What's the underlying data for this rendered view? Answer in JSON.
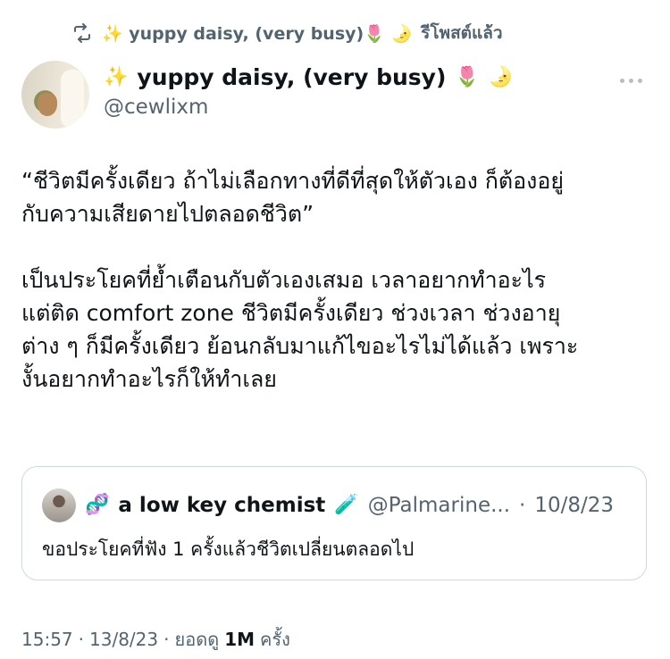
{
  "retweet": {
    "icon": "retweet-icon",
    "user_name": "✨ yuppy daisy, (very busy)🌷 🌛",
    "label": "รีโพสต์แล้ว"
  },
  "author": {
    "display_name": "yuppy daisy, (very busy)",
    "emoji_before": "✨",
    "emoji_after_1": "🌷",
    "emoji_after_2": "🌛",
    "handle": "@cewlixm"
  },
  "tweet": {
    "paragraph1_line1": "“ชีวิตมีครั้งเดียว ถ้าไม่เลือกทางที่ดีที่สุดให้ตัวเอง ก็ต้องอยู่",
    "paragraph1_line2": "กับความเสียดายไปตลอดชีวิต”",
    "paragraph2_line1": "เป็นประโยคที่ย้ำเตือนกับตัวเองเสมอ เวลาอยากทำอะไร",
    "paragraph2_line2": "แต่ติด comfort zone ชีวิตมีครั้งเดียว ช่วงเวลา ช่วงอายุ",
    "paragraph2_line3": "ต่าง ๆ ก็มีครั้งเดียว ย้อนกลับมาแก้ไขอะไรไม่ได้แล้ว เพราะ",
    "paragraph2_line4": "งั้นอยากทำอะไรก็ให้ทำเลย"
  },
  "quote": {
    "emoji_before": "🧬",
    "name": "a low key chemist",
    "emoji_after": "🧪",
    "handle": "@Palmarine...",
    "separator": "·",
    "date": "10/8/23",
    "text": "ขอประโยคที่ฟัง 1 ครั้งแล้วชีวิตเปลี่ยนตลอดไป"
  },
  "footer": {
    "time": "15:57",
    "sep1": "·",
    "date": "13/8/23",
    "sep2": "·",
    "views_label": "ยอดดู",
    "views_count": "1M",
    "views_suffix": "ครั้ง"
  },
  "colors": {
    "text_primary": "#0f1419",
    "text_secondary": "#536471",
    "border": "#cfd9de"
  }
}
